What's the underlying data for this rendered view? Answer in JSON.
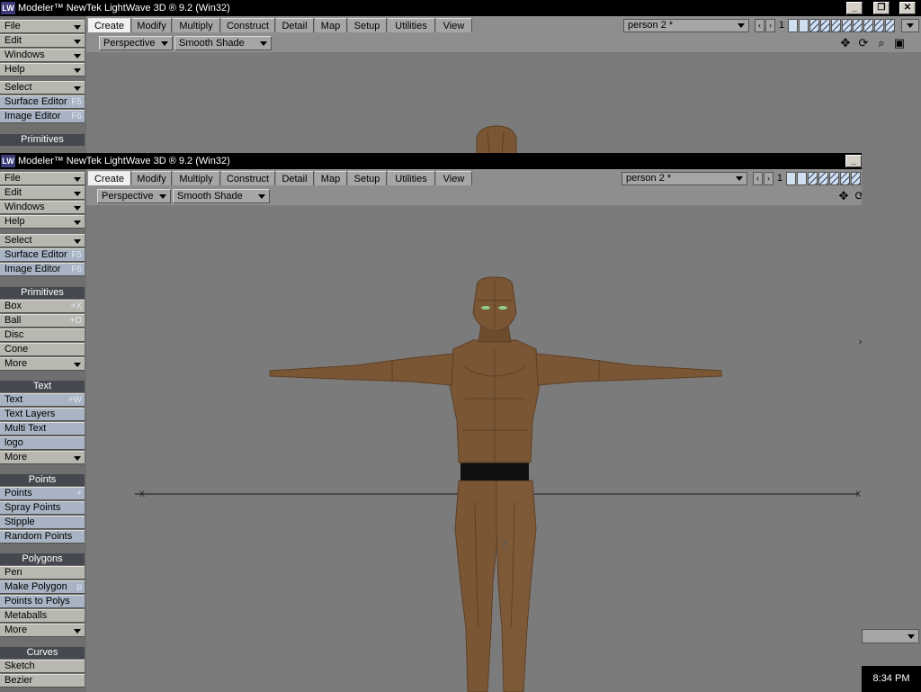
{
  "app": {
    "title": "Modeler™ NewTek LightWave 3D ® 9.2 (Win32)",
    "logo_text": "LW"
  },
  "menus": [
    "File",
    "Edit",
    "Windows",
    "Help"
  ],
  "sidebar": {
    "select": "Select",
    "surface_editor": {
      "label": "Surface Editor",
      "shortcut": "F5"
    },
    "image_editor": {
      "label": "Image Editor",
      "shortcut": "F6"
    },
    "primitives": {
      "header": "Primitives",
      "items": [
        {
          "label": "Box",
          "shortcut": "+X"
        },
        {
          "label": "Ball",
          "shortcut": "+O"
        },
        {
          "label": "Disc",
          "shortcut": ""
        },
        {
          "label": "Cone",
          "shortcut": ""
        },
        {
          "label": "More",
          "shortcut": ""
        }
      ]
    },
    "text": {
      "header": "Text",
      "items": [
        {
          "label": "Text",
          "shortcut": "+W"
        },
        {
          "label": "Text Layers",
          "shortcut": ""
        },
        {
          "label": "Multi Text",
          "shortcut": ""
        },
        {
          "label": "logo",
          "shortcut": ""
        },
        {
          "label": "More",
          "shortcut": ""
        }
      ]
    },
    "points": {
      "header": "Points",
      "items": [
        {
          "label": "Points",
          "shortcut": "+"
        },
        {
          "label": "Spray Points",
          "shortcut": ""
        },
        {
          "label": "Stipple",
          "shortcut": ""
        },
        {
          "label": "Random Points",
          "shortcut": ""
        }
      ]
    },
    "polygons": {
      "header": "Polygons",
      "items": [
        {
          "label": "Pen",
          "shortcut": ""
        },
        {
          "label": "Make Polygon",
          "shortcut": "p"
        },
        {
          "label": "Points to Polys",
          "shortcut": ""
        },
        {
          "label": "Metaballs",
          "shortcut": ""
        },
        {
          "label": "More",
          "shortcut": ""
        }
      ]
    },
    "curves": {
      "header": "Curves",
      "items": [
        {
          "label": "Sketch",
          "shortcut": ""
        },
        {
          "label": "Bezier",
          "shortcut": ""
        }
      ]
    },
    "back_primitives_header": "Primitives"
  },
  "tabs": [
    "Create",
    "Modify",
    "Multiply",
    "Construct",
    "Detail",
    "Map",
    "Setup",
    "Utilities",
    "View"
  ],
  "active_tab": "Create",
  "viewport": {
    "view_mode": "Perspective",
    "shade_mode": "Smooth Shade",
    "object": "person 2 *",
    "layer_number": "1",
    "axis_x_left": "-X",
    "axis_x_right": "X",
    "axis_z": "Z"
  },
  "window_controls": {
    "minimize": "_",
    "restore": "❐",
    "close": "✕"
  },
  "taskbar": {
    "time": "8:34 PM"
  },
  "colors": {
    "titlebar": "#000000",
    "viewport_bg": "#7b7b7b",
    "skin": "#7a5634",
    "belt": "#111111",
    "eyes": "#8fd08f",
    "section_header": "#45484f",
    "blue_button": "#a8b4c4"
  }
}
